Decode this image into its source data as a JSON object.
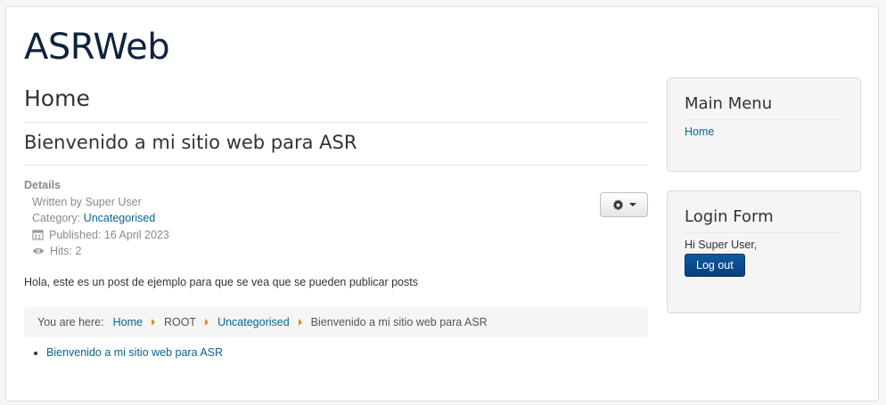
{
  "site": {
    "title": "ASRWeb"
  },
  "main": {
    "page_heading": "Home",
    "article_title": "Bienvenido a mi sitio web para ASR",
    "details": {
      "title": "Details",
      "written_by": "Written by Super User",
      "category_label": "Category: ",
      "category_link": "Uncategorised",
      "published": "Published: 16 April 2023",
      "hits": "Hits: 2"
    },
    "body": "Hola, este es un post de ejemplo para que se vea que se pueden publicar posts",
    "breadcrumb": {
      "label": "You are here:",
      "items": [
        "Home",
        "ROOT",
        "Uncategorised",
        "Bienvenido a mi sitio web para ASR"
      ]
    },
    "list": [
      "Bienvenido a mi sitio web para ASR"
    ]
  },
  "sidebar": {
    "main_menu": {
      "title": "Main Menu",
      "items": [
        "Home"
      ]
    },
    "login_form": {
      "title": "Login Form",
      "greeting": "Hi Super User,",
      "logout_label": "Log out"
    }
  },
  "icons": {
    "tools": "gear-icon",
    "published": "calendar-icon",
    "hits": "eye-icon"
  },
  "colors": {
    "link": "#08648f",
    "breadcrumb_separator": "#e48b1a",
    "button": "#0a3e7a"
  }
}
